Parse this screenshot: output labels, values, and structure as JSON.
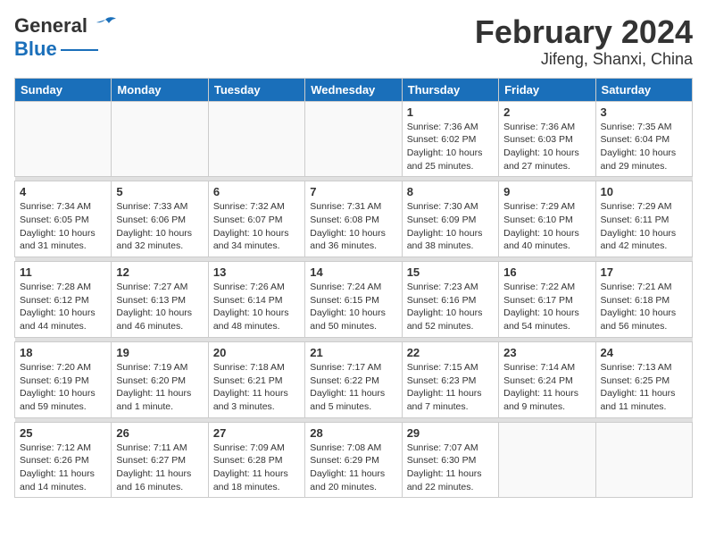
{
  "header": {
    "logo_general": "General",
    "logo_blue": "Blue",
    "title": "February 2024",
    "subtitle": "Jifeng, Shanxi, China"
  },
  "weekdays": [
    "Sunday",
    "Monday",
    "Tuesday",
    "Wednesday",
    "Thursday",
    "Friday",
    "Saturday"
  ],
  "weeks": [
    [
      {
        "day": "",
        "info": ""
      },
      {
        "day": "",
        "info": ""
      },
      {
        "day": "",
        "info": ""
      },
      {
        "day": "",
        "info": ""
      },
      {
        "day": "1",
        "info": "Sunrise: 7:36 AM\nSunset: 6:02 PM\nDaylight: 10 hours\nand 25 minutes."
      },
      {
        "day": "2",
        "info": "Sunrise: 7:36 AM\nSunset: 6:03 PM\nDaylight: 10 hours\nand 27 minutes."
      },
      {
        "day": "3",
        "info": "Sunrise: 7:35 AM\nSunset: 6:04 PM\nDaylight: 10 hours\nand 29 minutes."
      }
    ],
    [
      {
        "day": "4",
        "info": "Sunrise: 7:34 AM\nSunset: 6:05 PM\nDaylight: 10 hours\nand 31 minutes."
      },
      {
        "day": "5",
        "info": "Sunrise: 7:33 AM\nSunset: 6:06 PM\nDaylight: 10 hours\nand 32 minutes."
      },
      {
        "day": "6",
        "info": "Sunrise: 7:32 AM\nSunset: 6:07 PM\nDaylight: 10 hours\nand 34 minutes."
      },
      {
        "day": "7",
        "info": "Sunrise: 7:31 AM\nSunset: 6:08 PM\nDaylight: 10 hours\nand 36 minutes."
      },
      {
        "day": "8",
        "info": "Sunrise: 7:30 AM\nSunset: 6:09 PM\nDaylight: 10 hours\nand 38 minutes."
      },
      {
        "day": "9",
        "info": "Sunrise: 7:29 AM\nSunset: 6:10 PM\nDaylight: 10 hours\nand 40 minutes."
      },
      {
        "day": "10",
        "info": "Sunrise: 7:29 AM\nSunset: 6:11 PM\nDaylight: 10 hours\nand 42 minutes."
      }
    ],
    [
      {
        "day": "11",
        "info": "Sunrise: 7:28 AM\nSunset: 6:12 PM\nDaylight: 10 hours\nand 44 minutes."
      },
      {
        "day": "12",
        "info": "Sunrise: 7:27 AM\nSunset: 6:13 PM\nDaylight: 10 hours\nand 46 minutes."
      },
      {
        "day": "13",
        "info": "Sunrise: 7:26 AM\nSunset: 6:14 PM\nDaylight: 10 hours\nand 48 minutes."
      },
      {
        "day": "14",
        "info": "Sunrise: 7:24 AM\nSunset: 6:15 PM\nDaylight: 10 hours\nand 50 minutes."
      },
      {
        "day": "15",
        "info": "Sunrise: 7:23 AM\nSunset: 6:16 PM\nDaylight: 10 hours\nand 52 minutes."
      },
      {
        "day": "16",
        "info": "Sunrise: 7:22 AM\nSunset: 6:17 PM\nDaylight: 10 hours\nand 54 minutes."
      },
      {
        "day": "17",
        "info": "Sunrise: 7:21 AM\nSunset: 6:18 PM\nDaylight: 10 hours\nand 56 minutes."
      }
    ],
    [
      {
        "day": "18",
        "info": "Sunrise: 7:20 AM\nSunset: 6:19 PM\nDaylight: 10 hours\nand 59 minutes."
      },
      {
        "day": "19",
        "info": "Sunrise: 7:19 AM\nSunset: 6:20 PM\nDaylight: 11 hours\nand 1 minute."
      },
      {
        "day": "20",
        "info": "Sunrise: 7:18 AM\nSunset: 6:21 PM\nDaylight: 11 hours\nand 3 minutes."
      },
      {
        "day": "21",
        "info": "Sunrise: 7:17 AM\nSunset: 6:22 PM\nDaylight: 11 hours\nand 5 minutes."
      },
      {
        "day": "22",
        "info": "Sunrise: 7:15 AM\nSunset: 6:23 PM\nDaylight: 11 hours\nand 7 minutes."
      },
      {
        "day": "23",
        "info": "Sunrise: 7:14 AM\nSunset: 6:24 PM\nDaylight: 11 hours\nand 9 minutes."
      },
      {
        "day": "24",
        "info": "Sunrise: 7:13 AM\nSunset: 6:25 PM\nDaylight: 11 hours\nand 11 minutes."
      }
    ],
    [
      {
        "day": "25",
        "info": "Sunrise: 7:12 AM\nSunset: 6:26 PM\nDaylight: 11 hours\nand 14 minutes."
      },
      {
        "day": "26",
        "info": "Sunrise: 7:11 AM\nSunset: 6:27 PM\nDaylight: 11 hours\nand 16 minutes."
      },
      {
        "day": "27",
        "info": "Sunrise: 7:09 AM\nSunset: 6:28 PM\nDaylight: 11 hours\nand 18 minutes."
      },
      {
        "day": "28",
        "info": "Sunrise: 7:08 AM\nSunset: 6:29 PM\nDaylight: 11 hours\nand 20 minutes."
      },
      {
        "day": "29",
        "info": "Sunrise: 7:07 AM\nSunset: 6:30 PM\nDaylight: 11 hours\nand 22 minutes."
      },
      {
        "day": "",
        "info": ""
      },
      {
        "day": "",
        "info": ""
      }
    ]
  ]
}
